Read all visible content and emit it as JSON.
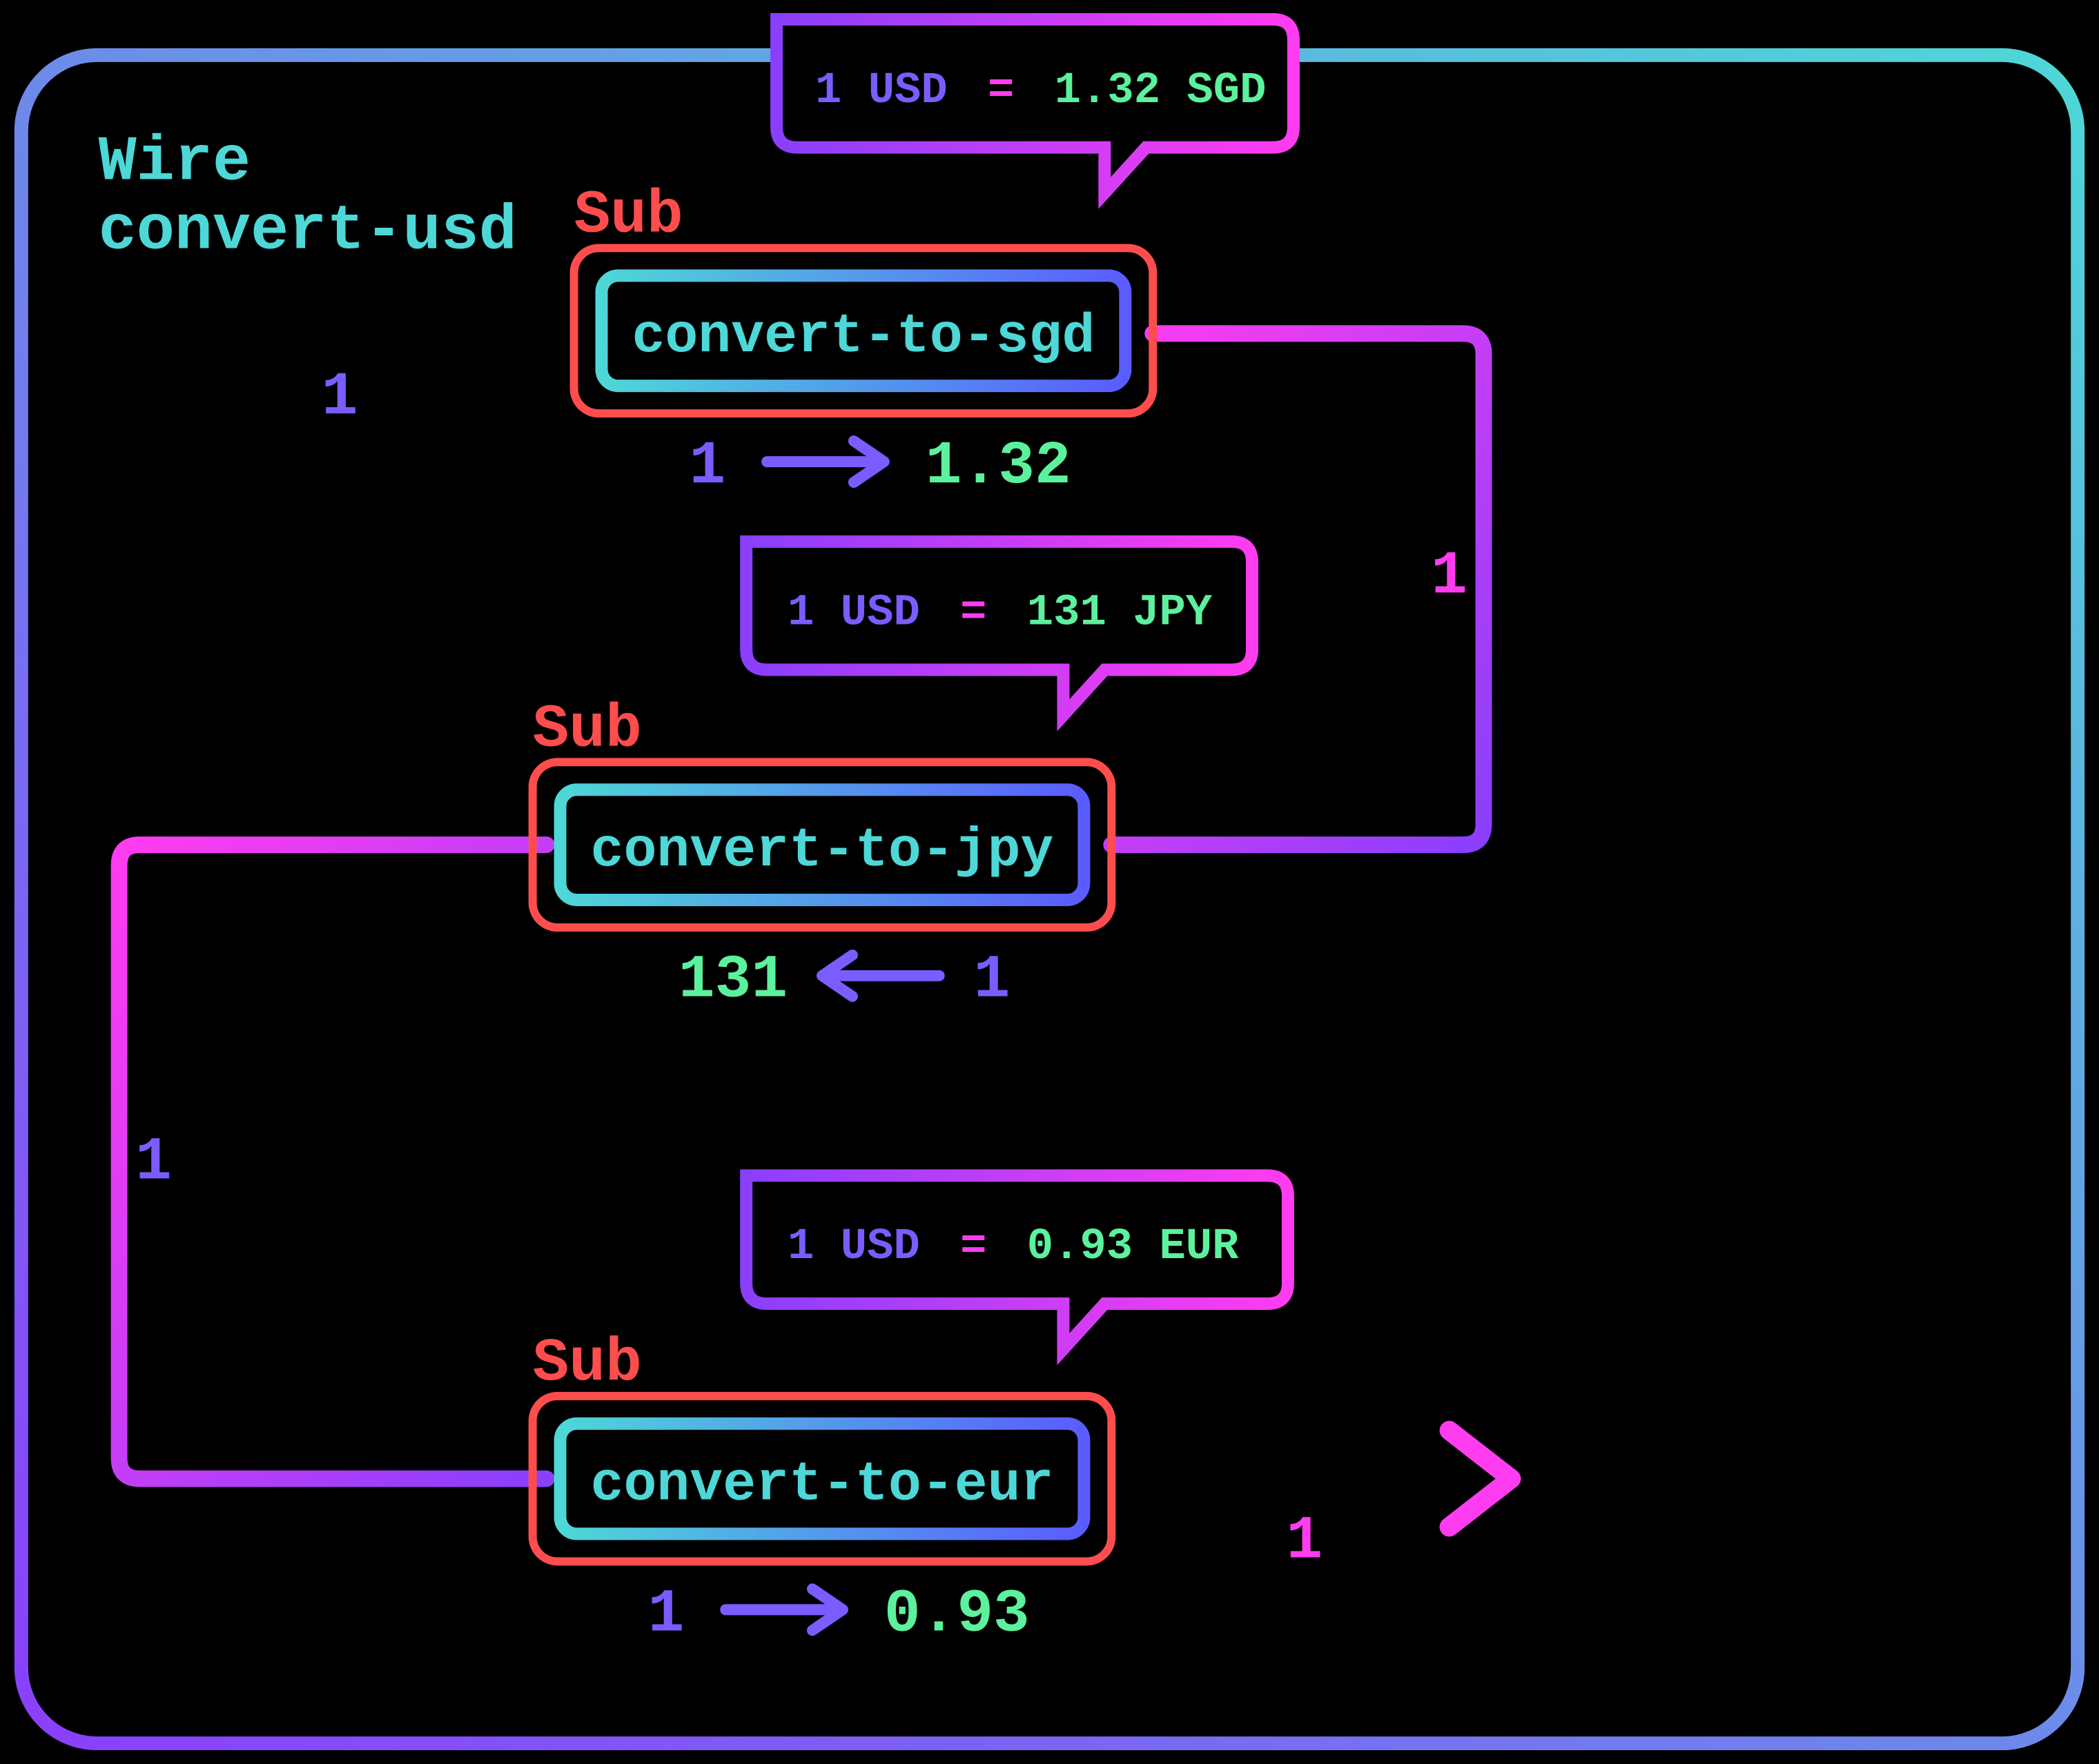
{
  "colors": {
    "cyan": "#4ED7D7",
    "blue": "#5AA5E6",
    "purple": "#8A3FFC",
    "magenta": "#FF3CF0",
    "green": "#5CF19C",
    "red": "#FF4D4D",
    "indigo": "#7B5CFF"
  },
  "frame": {
    "title_line1": "Wire",
    "title_line2": "convert-usd"
  },
  "nodes": [
    {
      "id": "sgd",
      "sub_label": "Sub",
      "name": "convert-to-sgd",
      "tooltip_left": "1 USD",
      "tooltip_eq": "=",
      "tooltip_right": "1.32 SGD",
      "io_left": "1",
      "io_arrow_dir": "right",
      "io_right": "1.32"
    },
    {
      "id": "jpy",
      "sub_label": "Sub",
      "name": "convert-to-jpy",
      "tooltip_left": "1 USD",
      "tooltip_eq": "=",
      "tooltip_right": "131 JPY",
      "io_left": "131",
      "io_arrow_dir": "left",
      "io_right": "1"
    },
    {
      "id": "eur",
      "sub_label": "Sub",
      "name": "convert-to-eur",
      "tooltip_left": "1 USD",
      "tooltip_eq": "=",
      "tooltip_right": "0.93 EUR",
      "io_left": "1",
      "io_arrow_dir": "right",
      "io_right": "0.93"
    }
  ],
  "wire_values": {
    "segment1": "1",
    "segment2": "1",
    "segment3": "1",
    "segment4": "1"
  }
}
